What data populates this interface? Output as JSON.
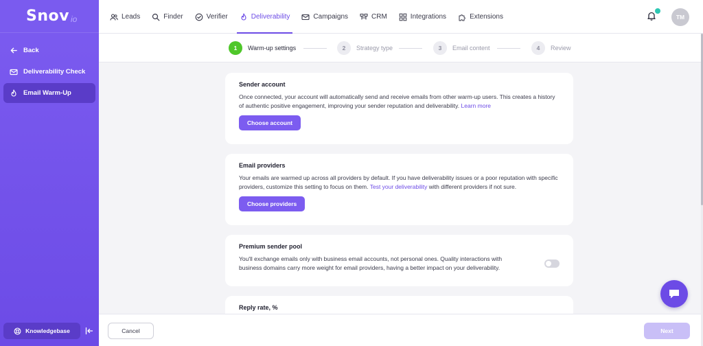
{
  "brand": {
    "name": "Snov",
    "suffix": "io",
    "accent": "#6c4be6"
  },
  "sidebar": {
    "items": [
      {
        "label": "Back",
        "icon": "arrow-left-icon",
        "active": false
      },
      {
        "label": "Deliverability Check",
        "icon": "envelope-check-icon",
        "active": false
      },
      {
        "label": "Email Warm-Up",
        "icon": "flame-icon",
        "active": true
      }
    ],
    "knowledgebase_label": "Knowledgebase"
  },
  "topnav": {
    "items": [
      {
        "label": "Leads",
        "icon": "users-icon"
      },
      {
        "label": "Finder",
        "icon": "search-icon"
      },
      {
        "label": "Verifier",
        "icon": "check-circle-icon"
      },
      {
        "label": "Deliverability",
        "icon": "flame-icon",
        "active": true
      },
      {
        "label": "Campaigns",
        "icon": "envelope-icon"
      },
      {
        "label": "CRM",
        "icon": "crm-icon"
      },
      {
        "label": "Integrations",
        "icon": "grid-icon"
      },
      {
        "label": "Extensions",
        "icon": "puzzle-icon"
      }
    ],
    "avatar_initials": "TM"
  },
  "stepper": {
    "steps": [
      {
        "num": "1",
        "label": "Warm-up settings",
        "active": true
      },
      {
        "num": "2",
        "label": "Strategy type",
        "active": false
      },
      {
        "num": "3",
        "label": "Email content",
        "active": false
      },
      {
        "num": "4",
        "label": "Review",
        "active": false
      }
    ]
  },
  "cards": {
    "sender": {
      "title": "Sender account",
      "text": "Once connected, your account will automatically send and receive emails from other warm-up users. This creates a history of authentic positive engagement, improving your sender reputation and deliverability.",
      "link": "Learn more",
      "button": "Choose account"
    },
    "providers": {
      "title": "Email providers",
      "text_before": "Your emails are warmed up across all providers by default. If you have deliverability issues or a poor reputation with specific providers, customize this setting to focus on them.",
      "link": "Test your deliverability",
      "text_after": "with different providers if not sure.",
      "button": "Choose providers"
    },
    "premium": {
      "title": "Premium sender pool",
      "text": "You'll exchange emails only with business email accounts, not personal ones. Quality interactions with business domains carry more weight for email providers, having a better impact on your deliverability.",
      "toggle_on": false
    },
    "reply": {
      "title": "Reply rate, %"
    }
  },
  "footer": {
    "cancel": "Cancel",
    "next": "Next"
  }
}
